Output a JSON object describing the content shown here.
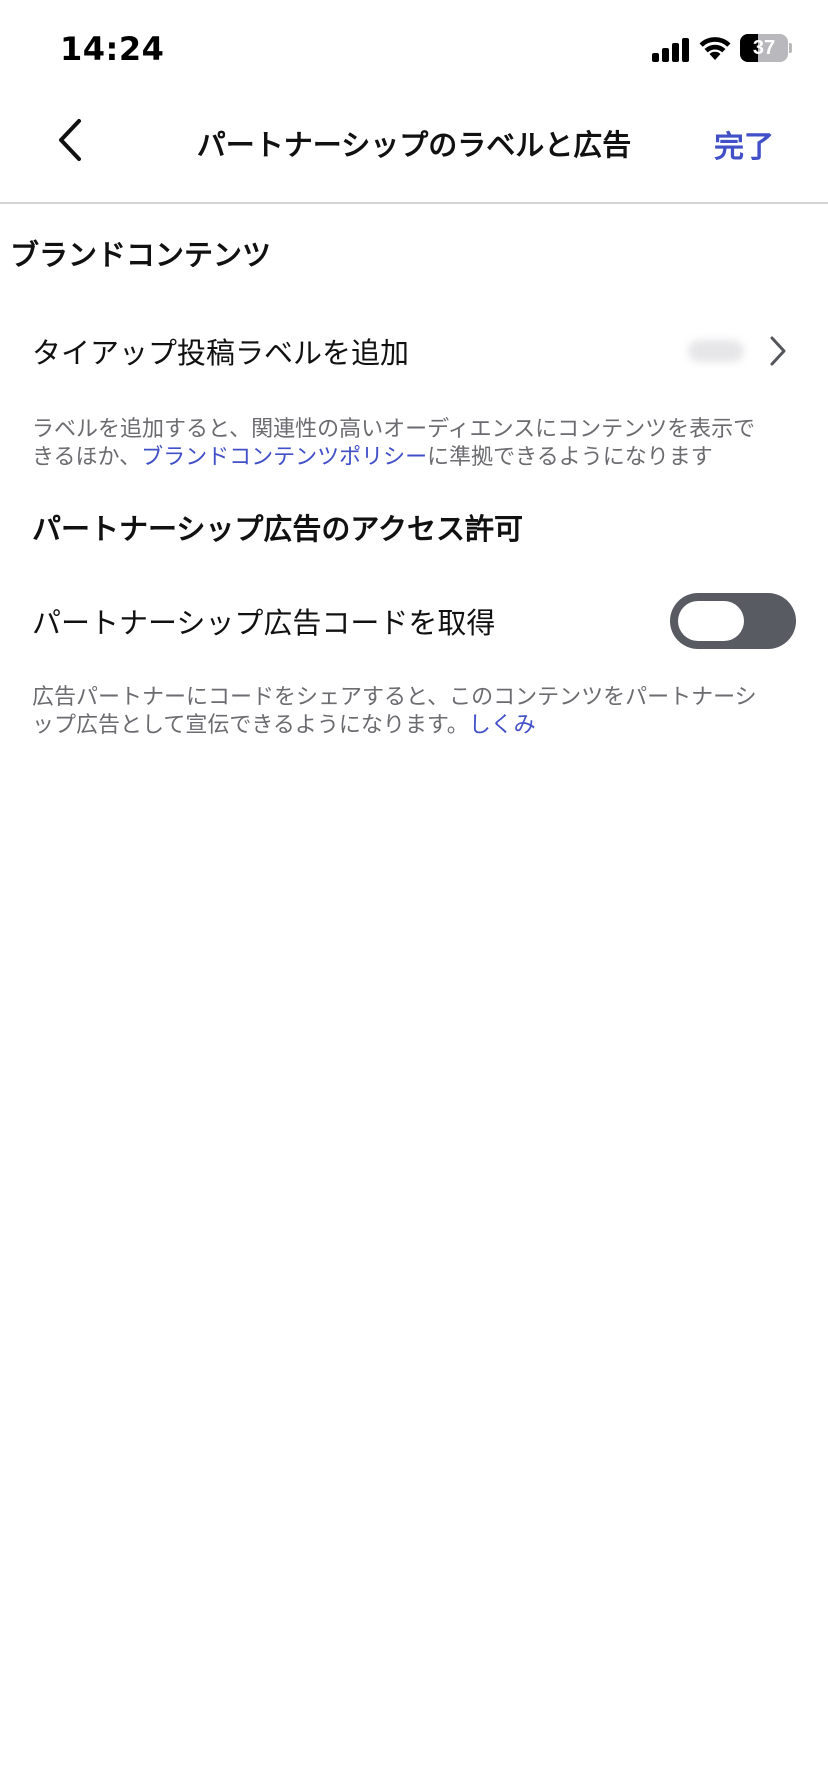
{
  "status_bar": {
    "time": "14:24",
    "battery_level": "37",
    "battery_fraction": 0.37,
    "icons": [
      "signal-icon",
      "wifi-icon",
      "battery-icon"
    ]
  },
  "nav": {
    "back_icon": "chevron-left-icon",
    "title": "パートナーシップのラベルと広告",
    "done_label": "完了"
  },
  "branded_content": {
    "title": "ブランドコンテンツ",
    "row_label": "タイアップ投稿ラベルを追加",
    "chevron_icon": "chevron-right-icon",
    "desc_line1": "ラベルを追加すると、関連性の高いオーディエンスにコンテンツを表示で",
    "desc_line2_prefix": "きるほか、",
    "desc_link": "ブランドコンテンツポリシー",
    "desc_line2_suffix": "に準拠できるようになります"
  },
  "partnership_ads": {
    "title": "パートナーシップ広告のアクセス許可",
    "row_label": "パートナーシップ広告コードを取得",
    "toggle_state": "off",
    "desc_line1": "広告パートナーにコードをシェアすると、このコンテンツをパートナーシ",
    "desc_line2_prefix": "ップ広告として宣伝できるようになります。",
    "desc_link": "しくみ"
  },
  "colors": {
    "accent": "#4150c7",
    "toggle_off": "#595b63",
    "secondary_text": "#6b6b70",
    "divider": "#d5d5d8"
  }
}
